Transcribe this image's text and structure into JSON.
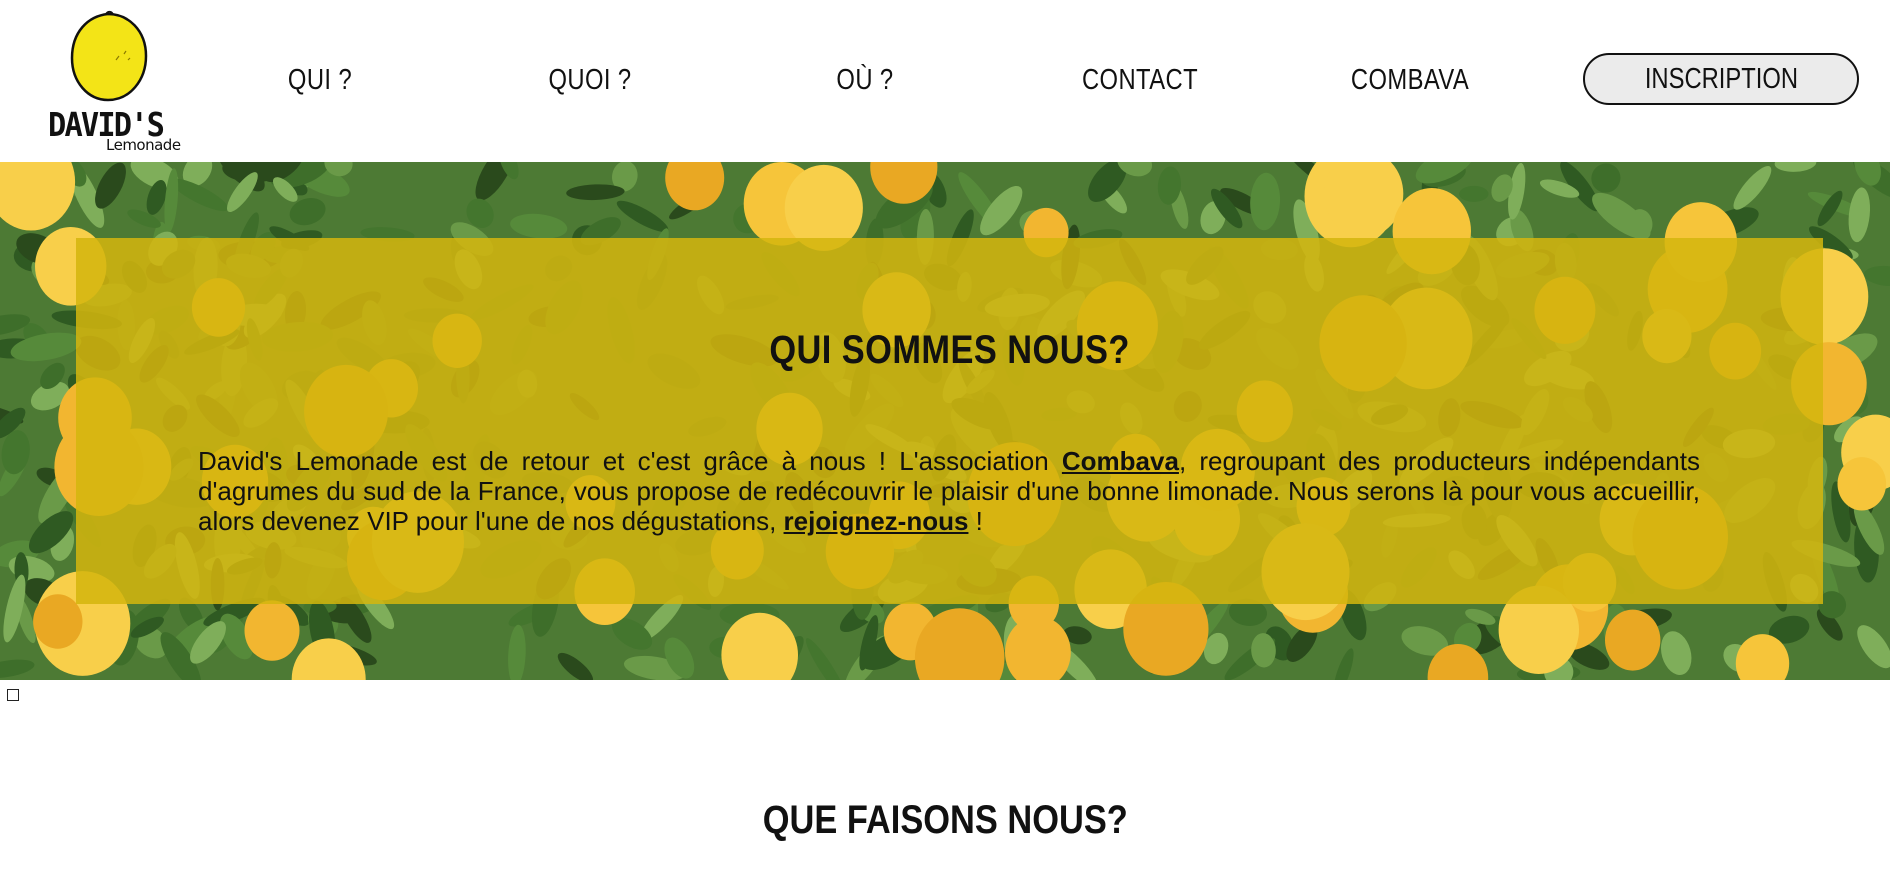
{
  "brand": {
    "name": "DAVID'S",
    "tagline": "Lemonade",
    "lemon_color": "#f3e417"
  },
  "nav": {
    "items": [
      {
        "label": "QUI ?"
      },
      {
        "label": "QUOI ?"
      },
      {
        "label": "OÙ ?"
      },
      {
        "label": "CONTACT"
      },
      {
        "label": "COMBAVA"
      }
    ],
    "cta_label": "INSCRIPTION"
  },
  "hero": {
    "title": "QUI SOMMES NOUS?",
    "text_part1": "David's Lemonade est de retour et c'est grâce à nous ! L'association ",
    "link1": "Combava",
    "text_part2": ", regroupant des producteurs indépendants d'agrumes du sud de la France, vous propose de redécouvrir le plaisir d'une bonne limonade. Nous serons là pour vous accueillir, alors devenez VIP pour l'une de nos dégustations, ",
    "link2": "rejoignez-nous",
    "text_part3": " !",
    "overlay_color": "#d4b60e"
  },
  "section2": {
    "title": "QUE FAISONS NOUS?"
  }
}
